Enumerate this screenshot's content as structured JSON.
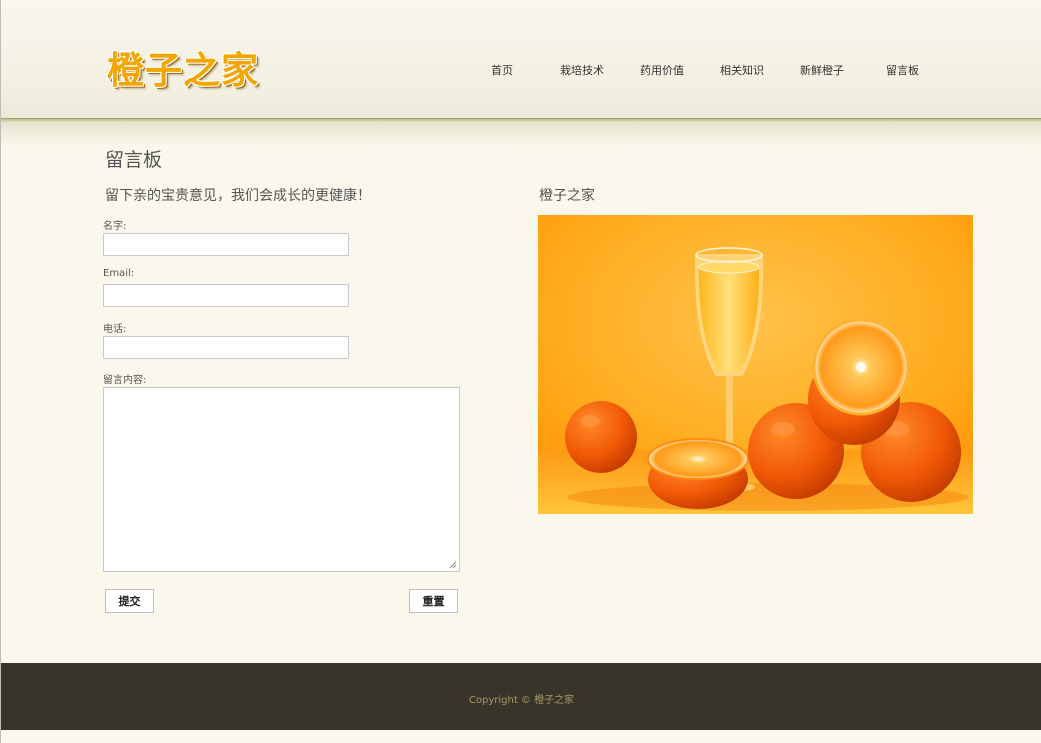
{
  "site": {
    "logo_text": "橙子之家"
  },
  "nav": {
    "items": [
      {
        "label": "首页"
      },
      {
        "label": "栽培技术"
      },
      {
        "label": "药用价值"
      },
      {
        "label": "相关知识"
      },
      {
        "label": "新鲜橙子"
      },
      {
        "label": "留言板"
      }
    ]
  },
  "main": {
    "page_title": "留言板",
    "form": {
      "heading": "留下亲的宝贵意见，我们会成长的更健康！",
      "name_label": "名字:",
      "name_value": "",
      "email_label": "Email:",
      "email_value": "",
      "phone_label": "电话:",
      "phone_value": "",
      "message_label": "留言内容:",
      "message_value": "",
      "submit_label": "提交",
      "reset_label": "重置"
    },
    "sidebar": {
      "heading": "橙子之家"
    }
  },
  "footer": {
    "copyright": "Copyright © 橙子之家"
  }
}
